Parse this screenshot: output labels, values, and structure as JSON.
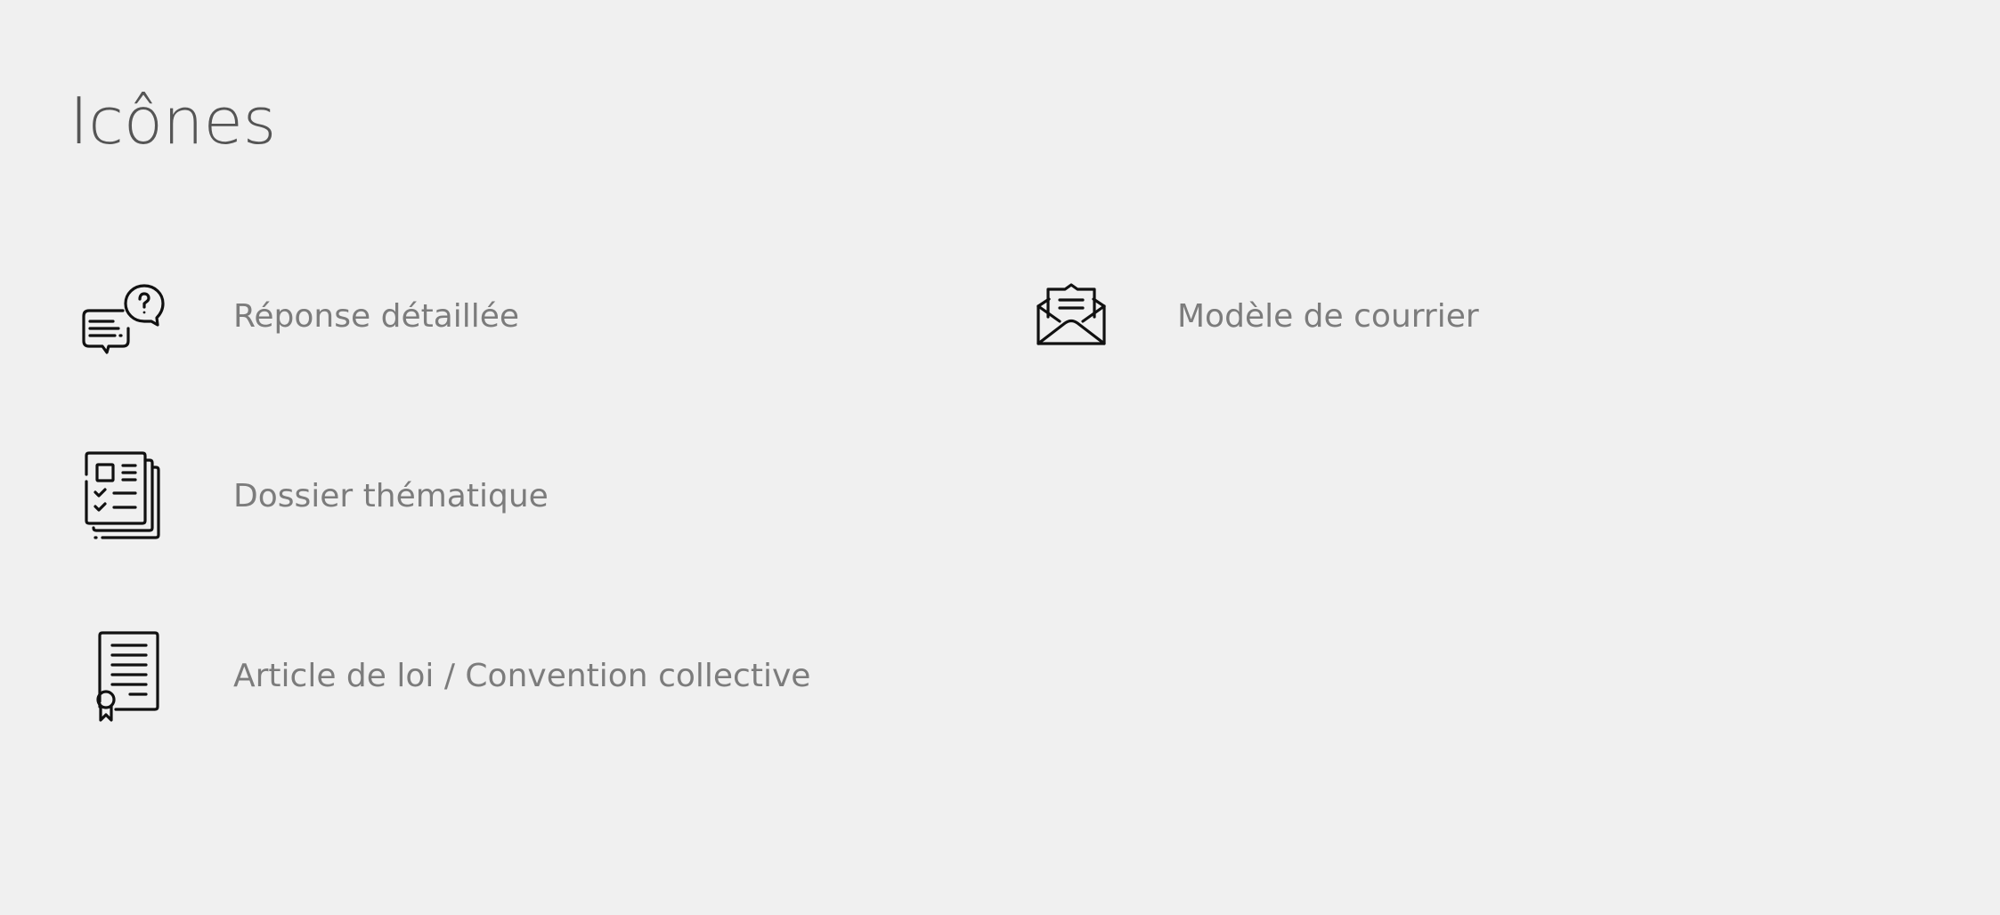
{
  "page": {
    "title": "Icônes"
  },
  "legend": {
    "items": [
      {
        "icon": "question-chat-icon",
        "label": "Réponse détaillée"
      },
      {
        "icon": "open-envelope-icon",
        "label": "Modèle de courrier"
      },
      {
        "icon": "document-stack-icon",
        "label": "Dossier thématique"
      },
      {
        "icon": "certificate-document-icon",
        "label": "Article de loi / Convention collective"
      }
    ]
  },
  "colors": {
    "background": "#f0f0f0",
    "title": "#555555",
    "label": "#7c7c7c",
    "icon_stroke": "#111111"
  }
}
